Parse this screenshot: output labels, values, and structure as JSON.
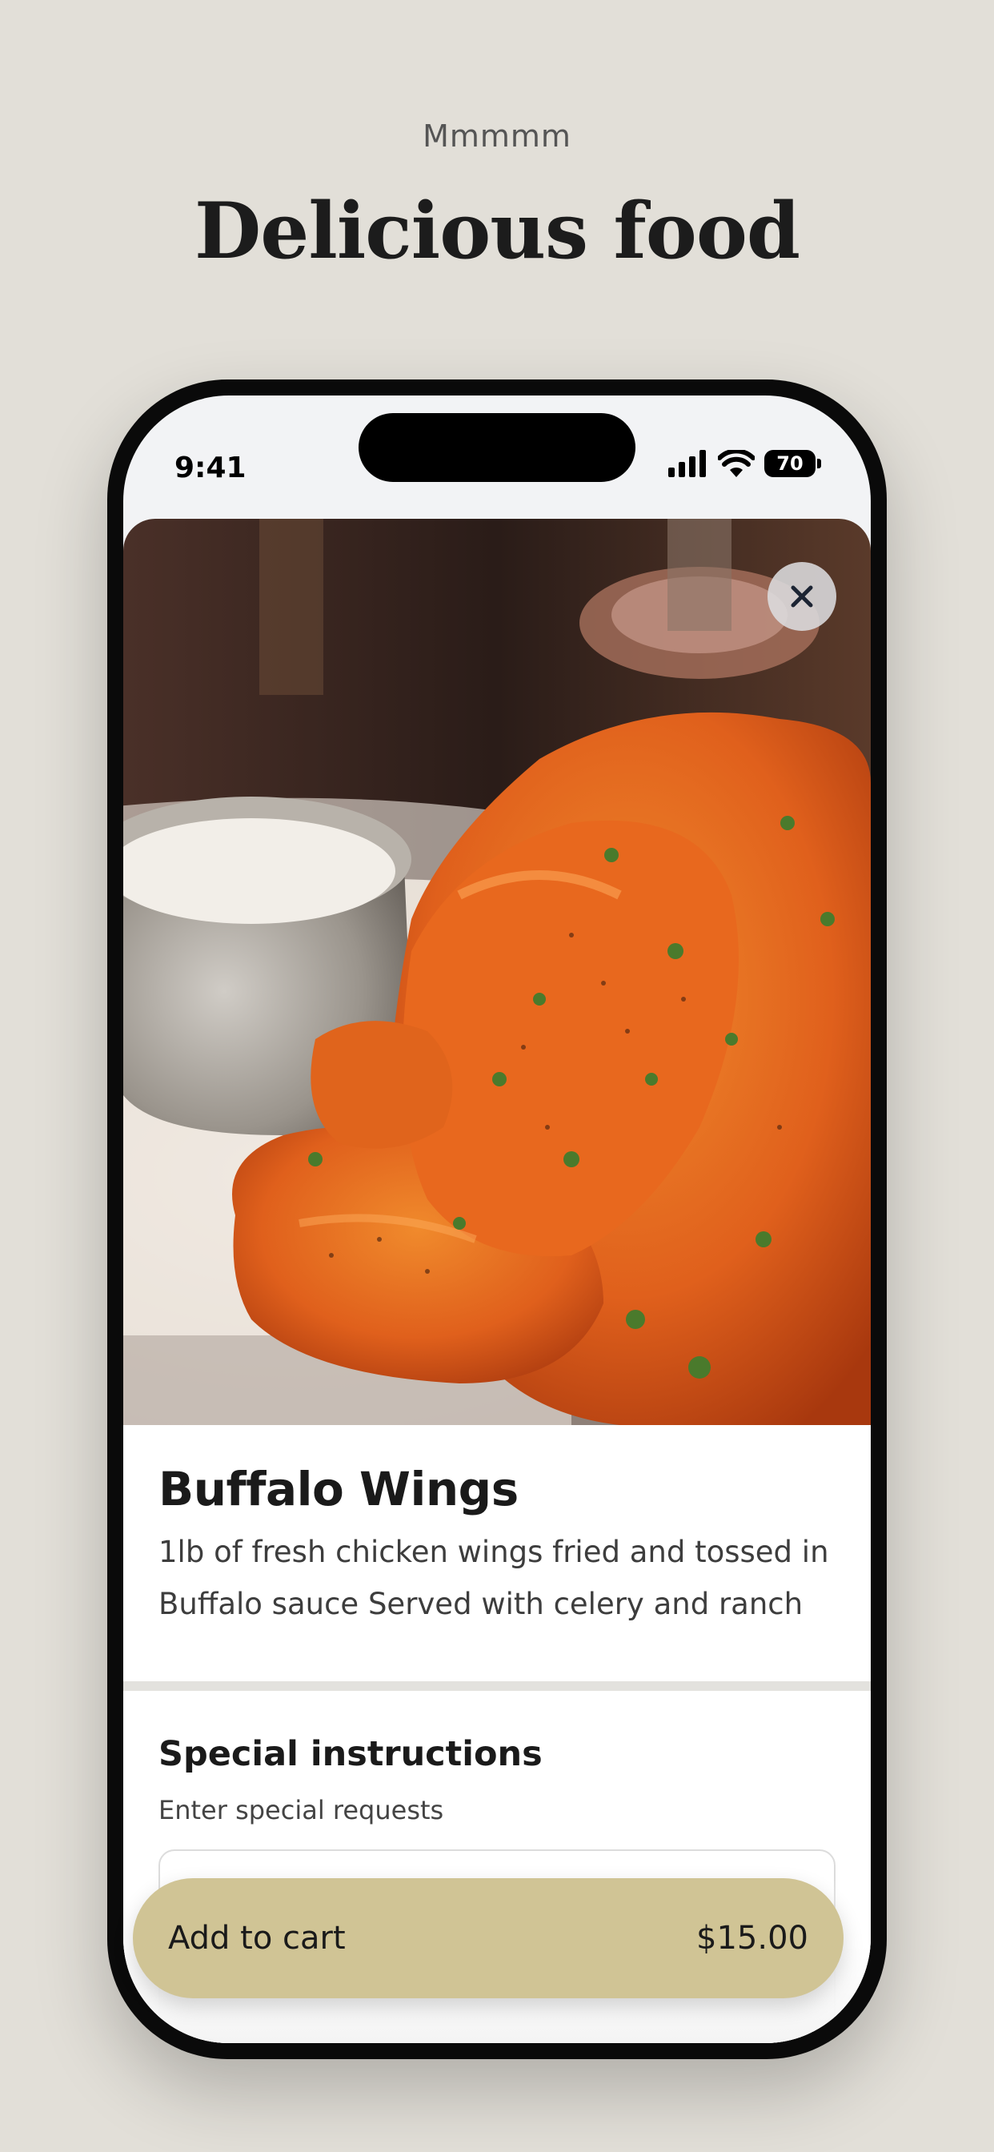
{
  "marketing": {
    "eyebrow": "Mmmmm",
    "headline": "Delicious food"
  },
  "status_bar": {
    "time": "9:41",
    "battery": "70",
    "icons": [
      "cellular-signal-icon",
      "wifi-icon",
      "battery-icon"
    ]
  },
  "item": {
    "image": "buffalo-wings-photo",
    "close_icon": "close-icon",
    "title": "Buffalo Wings",
    "description": "1lb of fresh chicken wings fried and tossed in Buffalo sauce Served with celery and ranch"
  },
  "instructions": {
    "title": "Special instructions",
    "subtitle": "Enter special requests",
    "value": ""
  },
  "cart": {
    "label": "Add to cart",
    "price": "$15.00"
  },
  "colors": {
    "background": "#e2dfd8",
    "button": "#d0c495",
    "text": "#1a1a1a",
    "divider": "#e3e2de"
  }
}
